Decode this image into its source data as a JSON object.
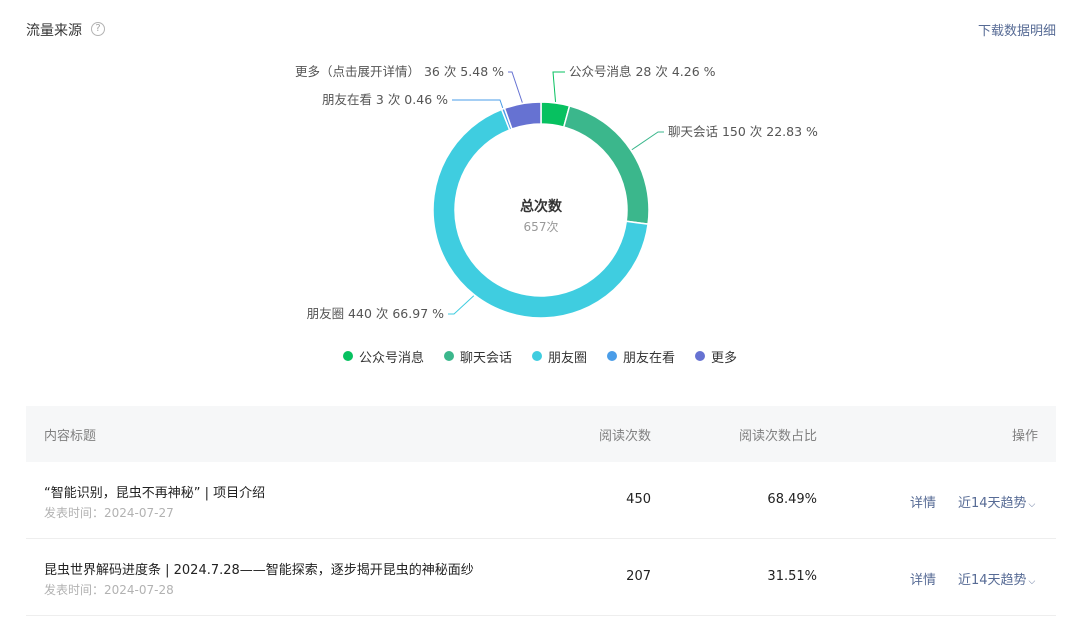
{
  "header": {
    "title": "流量来源",
    "help_icon": "?",
    "download_label": "下载数据明细"
  },
  "chart_data": {
    "type": "pie",
    "center_label": "总次数",
    "center_value": "657次",
    "total": 657,
    "slices": [
      {
        "name": "公众号消息",
        "count": 28,
        "percent": 4.26,
        "label": "公众号消息 28 次 4.26 %",
        "color": "#07c160"
      },
      {
        "name": "聊天会话",
        "count": 150,
        "percent": 22.83,
        "label": "聊天会话 150 次 22.83 %",
        "color": "#3bb78c"
      },
      {
        "name": "朋友圈",
        "count": 440,
        "percent": 66.97,
        "label": "朋友圈 440 次 66.97 %",
        "color": "#3fcde0"
      },
      {
        "name": "朋友在看",
        "count": 3,
        "percent": 0.46,
        "label": "朋友在看 3 次 0.46 %",
        "color": "#4a9de8"
      },
      {
        "name": "更多",
        "count": 36,
        "percent": 5.48,
        "label": "更多（点击展开详情） 36 次 5.48 %",
        "color": "#6672d2"
      }
    ],
    "legend_position": "bottom"
  },
  "table": {
    "headers": {
      "title": "内容标题",
      "reads": "阅读次数",
      "ratio": "阅读次数占比",
      "action": "操作"
    },
    "rows": [
      {
        "title": "“智能识别，昆虫不再神秘” | 项目介绍",
        "date": "发表时间：2024-07-27",
        "reads": "450",
        "ratio": "68.49%",
        "detail": "详情",
        "trend": "近14天趋势"
      },
      {
        "title": "昆虫世界解码进度条 | 2024.7.28——智能探索，逐步揭开昆虫的神秘面纱",
        "date": "发表时间：2024-07-28",
        "reads": "207",
        "ratio": "31.51%",
        "detail": "详情",
        "trend": "近14天趋势"
      }
    ]
  },
  "icons": {
    "chevron": "chevron-down-icon",
    "chevron_glyph": "⌵"
  }
}
